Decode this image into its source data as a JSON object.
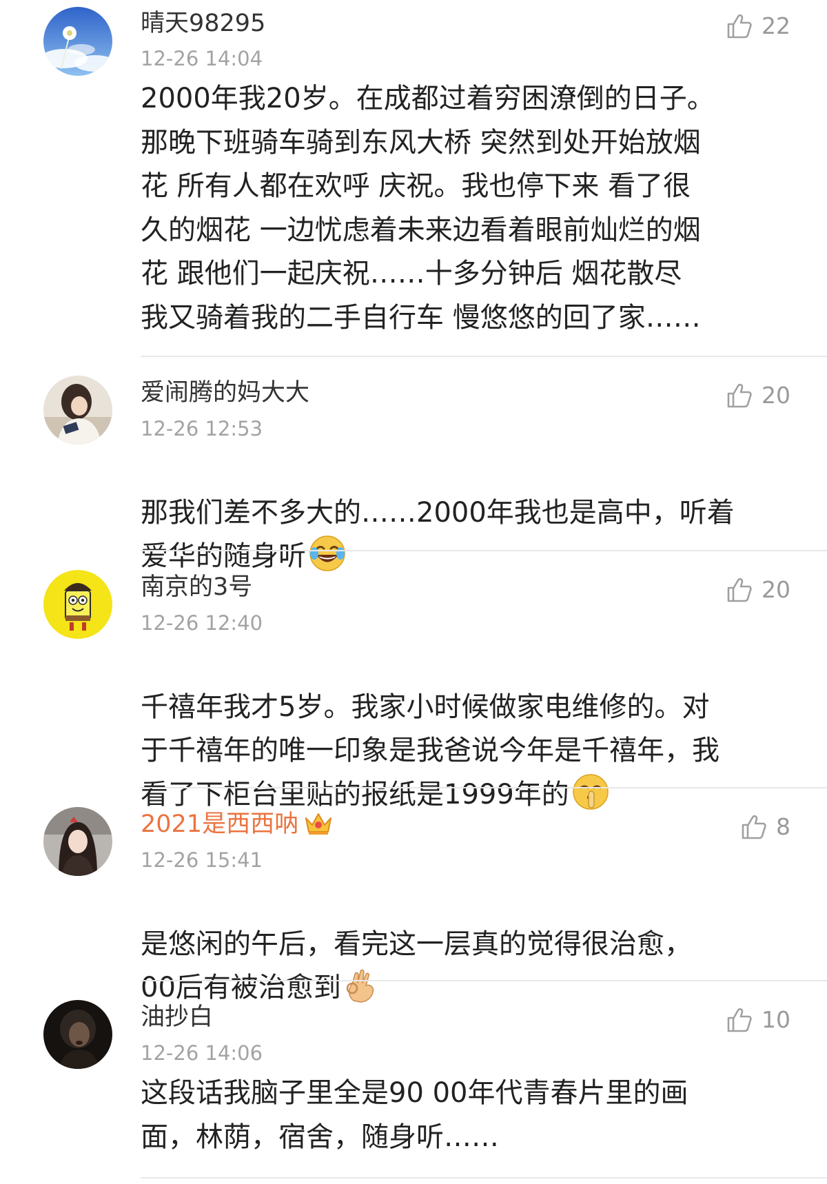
{
  "comments": [
    {
      "username": "晴天98295",
      "time": "12-26 14:04",
      "likes": "22",
      "avatar_icon": "avatar-sky-dandelion",
      "text": "2000年我20岁。在成都过着穷困潦倒的日子。\n那晚下班骑车骑到东风大桥  突然到处开始放烟\n花  所有人都在欢呼 庆祝。我也停下来  看了很\n久的烟花   一边忧虑着未来边看着眼前灿烂的烟\n花  跟他们一起庆祝……十多分钟后  烟花散尽\n我又骑着我的二手自行车   慢悠悠的回了家……"
    },
    {
      "username": "爱闹腾的妈大大",
      "time": "12-26 12:53",
      "likes": "20",
      "avatar_icon": "avatar-girl-photo",
      "text": "那我们差不多大的……2000年我也是高中，听着\n爱华的随身听",
      "emoji": "laughing-tears-emoji"
    },
    {
      "username": "南京的3号",
      "time": "12-26 12:40",
      "likes": "20",
      "avatar_icon": "avatar-spongebob",
      "text": "千禧年我才5岁。我家小时候做家电维修的。对\n于千禧年的唯一印象是我爸说今年是千禧年，我\n看了下柜台里贴的报纸是1999年的",
      "emoji": "shush-emoji"
    },
    {
      "username": "2021是西西呐",
      "time": "12-26 15:41",
      "likes": "8",
      "avatar_icon": "avatar-girl-portrait",
      "badge_icon": "vip-crown-icon",
      "name_color": "#eb7340",
      "text": "是悠闲的午后，看完这一层真的觉得很治愈，\n00后有被治愈到",
      "emoji": "ok-hand-emoji"
    },
    {
      "username": "油抄白",
      "time": "12-26 14:06",
      "likes": "10",
      "avatar_icon": "avatar-dark-portrait",
      "text": "这段话我脑子里全是90 00年代青春片里的画\n面，林荫，宿舍，随身听……"
    }
  ],
  "colors": {
    "username": "#333333",
    "vip_username": "#eb7340",
    "meta": "#a3a3a3",
    "divider": "#e8e8e8"
  }
}
